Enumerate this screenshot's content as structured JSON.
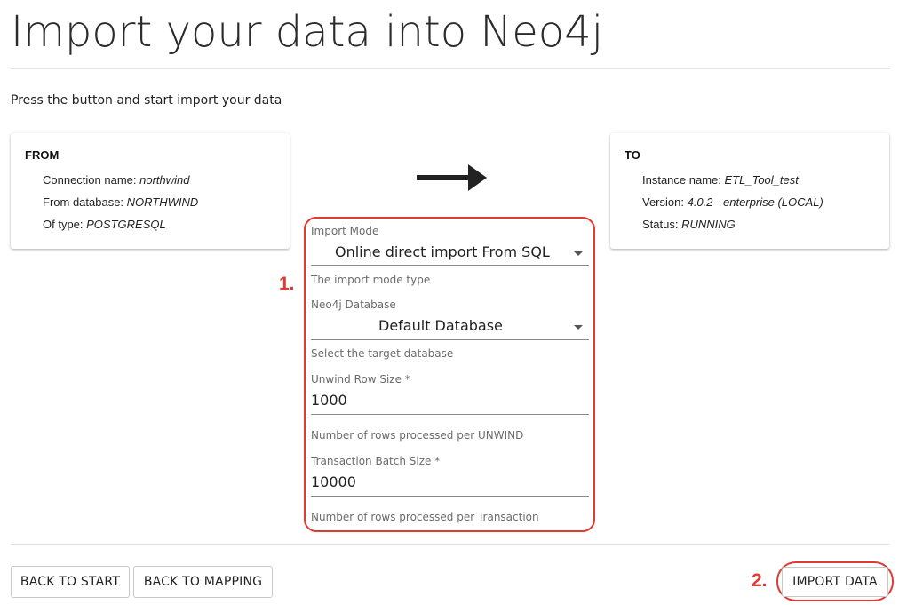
{
  "page": {
    "title": "Import your data into Neo4j",
    "subtitle": "Press the button and start import your data"
  },
  "from_card": {
    "heading": "FROM",
    "rows": [
      {
        "label": "Connection name: ",
        "value": "northwind"
      },
      {
        "label": "From database: ",
        "value": "NORTHWIND"
      },
      {
        "label": "Of type: ",
        "value": "POSTGRESQL"
      }
    ]
  },
  "to_card": {
    "heading": "TO",
    "rows": [
      {
        "label": "Instance name: ",
        "value": "ETL_Tool_test"
      },
      {
        "label": "Version: ",
        "value": "4.0.2 - enterprise (LOCAL)"
      },
      {
        "label": "Status: ",
        "value": "RUNNING"
      }
    ]
  },
  "form": {
    "import_mode": {
      "label": "Import Mode",
      "value": "Online direct import From SQL",
      "helper": "The import mode type"
    },
    "database": {
      "label": "Neo4j Database",
      "value": "Default Database",
      "helper": "Select the target database"
    },
    "unwind": {
      "label": "Unwind Row Size *",
      "value": "1000",
      "helper": "Number of rows processed per UNWIND"
    },
    "batch": {
      "label": "Transaction Batch Size *",
      "value": "10000",
      "helper": "Number of rows processed per Transaction"
    }
  },
  "annotations": {
    "step1": "1.",
    "step2": "2.",
    "highlight_color": "#e03a31"
  },
  "buttons": {
    "back_to_start": "BACK TO START",
    "back_to_mapping": "BACK TO MAPPING",
    "import_data": "IMPORT DATA"
  },
  "icons": {
    "arrow": "arrow-right-icon",
    "dropdown": "caret-down-icon"
  }
}
